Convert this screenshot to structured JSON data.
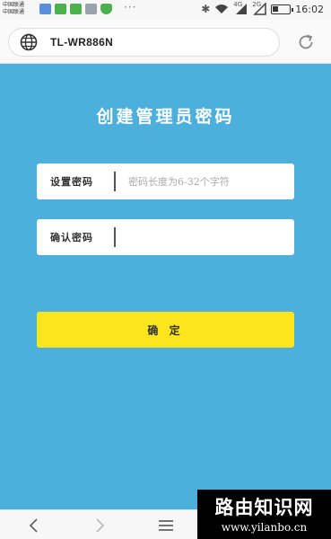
{
  "status_bar": {
    "carrier_line1": "中国联通",
    "carrier_line2": "中国联通",
    "more_dots": "···",
    "network_4g": "4G",
    "network_2g": "2G",
    "time": "16:02",
    "battery_level": 0.35
  },
  "address_bar": {
    "url": "TL-WR886N"
  },
  "page": {
    "title": "创建管理员密码",
    "password_label": "设置密码",
    "password_placeholder": "密码长度为6-32个字符",
    "confirm_label": "确认密码",
    "confirm_placeholder": "",
    "submit_label": "确 定"
  },
  "colors": {
    "page_background": "#4dafdb",
    "button": "#fbe61e"
  },
  "watermark": {
    "title": "路由知识网",
    "url": "www.yilanbo.cn"
  }
}
